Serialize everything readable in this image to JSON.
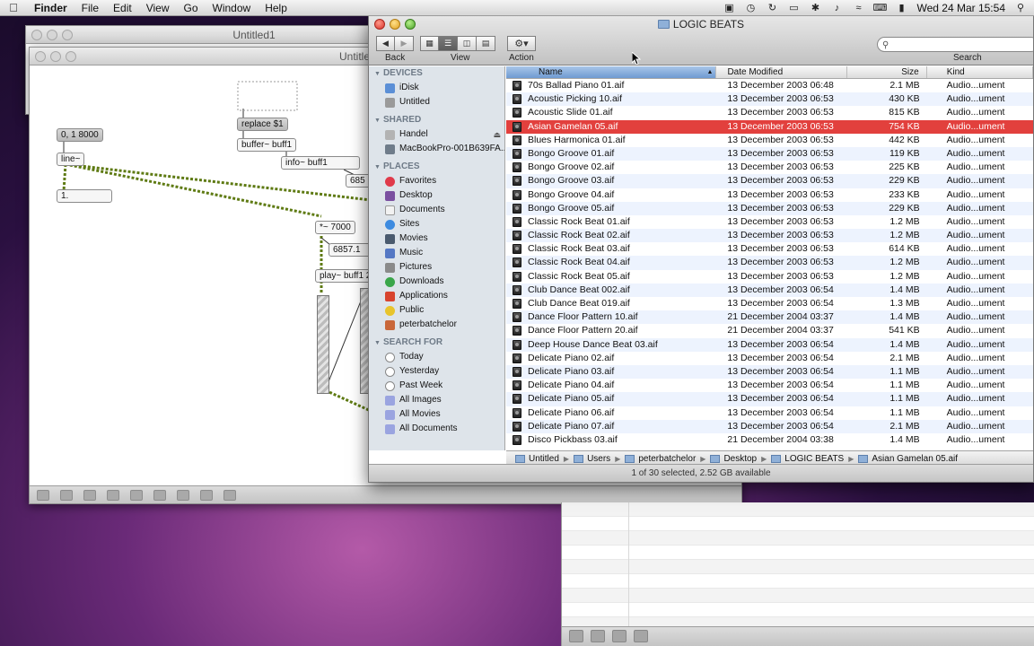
{
  "menubar": {
    "app": "Finder",
    "menus": [
      "File",
      "Edit",
      "View",
      "Go",
      "Window",
      "Help"
    ],
    "clock": "Wed 24 Mar  15:54"
  },
  "max": {
    "window1_title": "Untitled1",
    "window2_title": "Untitle",
    "objects": {
      "msg_line": "0, 1 8000",
      "line": "line~",
      "number": "1.",
      "replace": "replace $1",
      "buffer": "buffer~ buff1",
      "info": "info~ buff1",
      "times": "*~ 7000",
      "num6857": "6857.1",
      "play": "play~ buff1 2",
      "num685": "685"
    }
  },
  "finder": {
    "title": "LOGIC BEATS",
    "toolbar": {
      "back": "Back",
      "view": "View",
      "action": "Action",
      "search": "Search"
    },
    "sidebar": {
      "devices_header": "DEVICES",
      "devices": [
        "iDisk",
        "Untitled"
      ],
      "shared_header": "SHARED",
      "shared": [
        "Handel",
        "MacBookPro-001B639FA..."
      ],
      "places_header": "PLACES",
      "places": [
        "Favorites",
        "Desktop",
        "Documents",
        "Sites",
        "Movies",
        "Music",
        "Pictures",
        "Downloads",
        "Applications",
        "Public",
        "peterbatchelor"
      ],
      "search_header": "SEARCH FOR",
      "search": [
        "Today",
        "Yesterday",
        "Past Week",
        "All Images",
        "All Movies",
        "All Documents"
      ]
    },
    "columns": {
      "name": "Name",
      "date": "Date Modified",
      "size": "Size",
      "kind": "Kind"
    },
    "files": [
      {
        "name": "70s Ballad Piano 01.aif",
        "date": "13 December 2003 06:48",
        "size": "2.1 MB",
        "kind": "Audio...ument"
      },
      {
        "name": "Acoustic Picking 10.aif",
        "date": "13 December 2003 06:53",
        "size": "430 KB",
        "kind": "Audio...ument"
      },
      {
        "name": "Acoustic Slide 01.aif",
        "date": "13 December 2003 06:53",
        "size": "815 KB",
        "kind": "Audio...ument"
      },
      {
        "name": "Asian Gamelan 05.aif",
        "date": "13 December 2003 06:53",
        "size": "754 KB",
        "kind": "Audio...ument",
        "selected": true
      },
      {
        "name": "Blues Harmonica 01.aif",
        "date": "13 December 2003 06:53",
        "size": "442 KB",
        "kind": "Audio...ument"
      },
      {
        "name": "Bongo Groove 01.aif",
        "date": "13 December 2003 06:53",
        "size": "119 KB",
        "kind": "Audio...ument"
      },
      {
        "name": "Bongo Groove 02.aif",
        "date": "13 December 2003 06:53",
        "size": "225 KB",
        "kind": "Audio...ument"
      },
      {
        "name": "Bongo Groove 03.aif",
        "date": "13 December 2003 06:53",
        "size": "229 KB",
        "kind": "Audio...ument"
      },
      {
        "name": "Bongo Groove 04.aif",
        "date": "13 December 2003 06:53",
        "size": "233 KB",
        "kind": "Audio...ument"
      },
      {
        "name": "Bongo Groove 05.aif",
        "date": "13 December 2003 06:53",
        "size": "229 KB",
        "kind": "Audio...ument"
      },
      {
        "name": "Classic Rock Beat 01.aif",
        "date": "13 December 2003 06:53",
        "size": "1.2 MB",
        "kind": "Audio...ument"
      },
      {
        "name": "Classic Rock Beat 02.aif",
        "date": "13 December 2003 06:53",
        "size": "1.2 MB",
        "kind": "Audio...ument"
      },
      {
        "name": "Classic Rock Beat 03.aif",
        "date": "13 December 2003 06:53",
        "size": "614 KB",
        "kind": "Audio...ument"
      },
      {
        "name": "Classic Rock Beat 04.aif",
        "date": "13 December 2003 06:53",
        "size": "1.2 MB",
        "kind": "Audio...ument"
      },
      {
        "name": "Classic Rock Beat 05.aif",
        "date": "13 December 2003 06:53",
        "size": "1.2 MB",
        "kind": "Audio...ument"
      },
      {
        "name": "Club Dance Beat 002.aif",
        "date": "13 December 2003 06:54",
        "size": "1.4 MB",
        "kind": "Audio...ument"
      },
      {
        "name": "Club Dance Beat 019.aif",
        "date": "13 December 2003 06:54",
        "size": "1.3 MB",
        "kind": "Audio...ument"
      },
      {
        "name": "Dance Floor Pattern 10.aif",
        "date": "21 December 2004 03:37",
        "size": "1.4 MB",
        "kind": "Audio...ument"
      },
      {
        "name": "Dance Floor Pattern 20.aif",
        "date": "21 December 2004 03:37",
        "size": "541 KB",
        "kind": "Audio...ument"
      },
      {
        "name": "Deep House Dance Beat 03.aif",
        "date": "13 December 2003 06:54",
        "size": "1.4 MB",
        "kind": "Audio...ument"
      },
      {
        "name": "Delicate Piano 02.aif",
        "date": "13 December 2003 06:54",
        "size": "2.1 MB",
        "kind": "Audio...ument"
      },
      {
        "name": "Delicate Piano 03.aif",
        "date": "13 December 2003 06:54",
        "size": "1.1 MB",
        "kind": "Audio...ument"
      },
      {
        "name": "Delicate Piano 04.aif",
        "date": "13 December 2003 06:54",
        "size": "1.1 MB",
        "kind": "Audio...ument"
      },
      {
        "name": "Delicate Piano 05.aif",
        "date": "13 December 2003 06:54",
        "size": "1.1 MB",
        "kind": "Audio...ument"
      },
      {
        "name": "Delicate Piano 06.aif",
        "date": "13 December 2003 06:54",
        "size": "1.1 MB",
        "kind": "Audio...ument"
      },
      {
        "name": "Delicate Piano 07.aif",
        "date": "13 December 2003 06:54",
        "size": "2.1 MB",
        "kind": "Audio...ument"
      },
      {
        "name": "Disco Pickbass 03.aif",
        "date": "21 December 2004 03:38",
        "size": "1.4 MB",
        "kind": "Audio...ument"
      }
    ],
    "path": [
      "Untitled",
      "Users",
      "peterbatchelor",
      "Desktop",
      "LOGIC BEATS",
      "Asian Gamelan 05.aif"
    ],
    "status": "1 of 30 selected, 2.52 GB available",
    "colors": {
      "selection": "#e2403d",
      "sidebar_bg": "#dee4ea",
      "stripe": "#edf3fe"
    }
  }
}
